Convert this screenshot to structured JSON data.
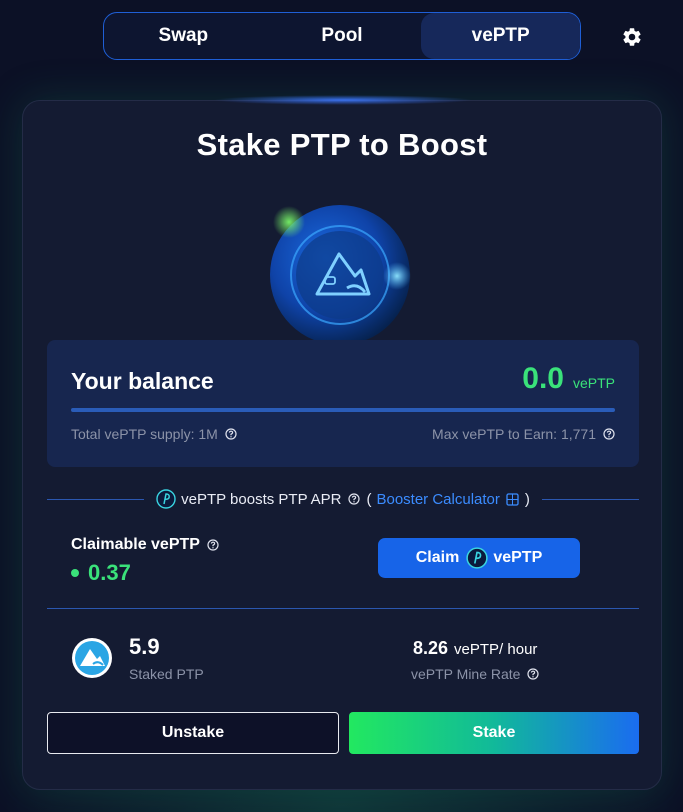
{
  "nav": {
    "tabs": [
      {
        "label": "Swap"
      },
      {
        "label": "Pool"
      },
      {
        "label": "vePTP"
      }
    ],
    "active_tab": "vePTP",
    "settings_icon": "gear-icon"
  },
  "card": {
    "title": "Stake PTP to Boost",
    "balance": {
      "label": "Your balance",
      "value": "0.0",
      "unit": "vePTP",
      "total_supply": "Total vePTP supply: 1M",
      "max_earn": "Max vePTP to Earn: 1,771"
    },
    "boost": {
      "text": "vePTP boosts PTP APR",
      "open_paren": "(",
      "link": "Booster Calculator",
      "close_paren": ")"
    },
    "claimable": {
      "label": "Claimable vePTP",
      "value": "0.37",
      "button_claim": "Claim",
      "button_unit": "vePTP"
    },
    "staked": {
      "value": "5.9",
      "label": "Staked PTP"
    },
    "mine_rate": {
      "value": "8.26",
      "unit": "vePTP/ hour",
      "label": "vePTP Mine Rate"
    },
    "actions": {
      "unstake": "Unstake",
      "stake": "Stake"
    }
  },
  "colors": {
    "accent_green": "#3ae27a",
    "accent_blue": "#1764e8",
    "background": "#0c1126"
  }
}
